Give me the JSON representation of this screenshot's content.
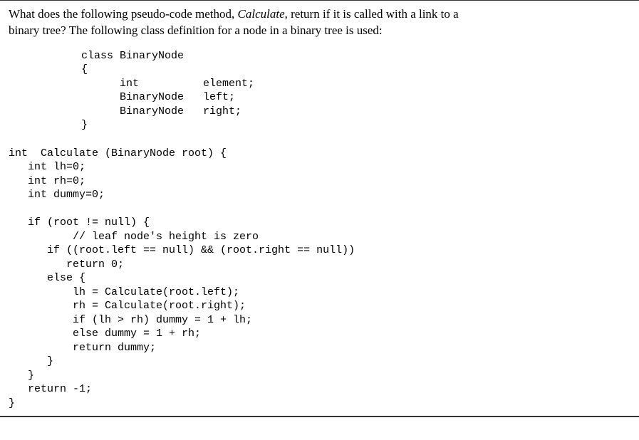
{
  "question": {
    "line1_pre": "What does the following pseudo-code method, ",
    "line1_em": "Calculate",
    "line1_post": ", return if it is called with a link to a",
    "line2": "binary tree?  The following class definition for a node in a binary tree is used:"
  },
  "code": {
    "classdef": "        class BinaryNode\n        {\n              int          element;\n              BinaryNode   left;\n              BinaryNode   right;\n        }",
    "method": "int  Calculate (BinaryNode root) {\n   int lh=0;\n   int rh=0;\n   int dummy=0;\n\n   if (root != null) {\n          // leaf node's height is zero\n      if ((root.left == null) && (root.right == null))\n         return 0;\n      else {\n          lh = Calculate(root.left);\n          rh = Calculate(root.right);\n          if (lh > rh) dummy = 1 + lh;\n          else dummy = 1 + rh;\n          return dummy;\n      }\n   }\n   return -1;\n}"
  }
}
